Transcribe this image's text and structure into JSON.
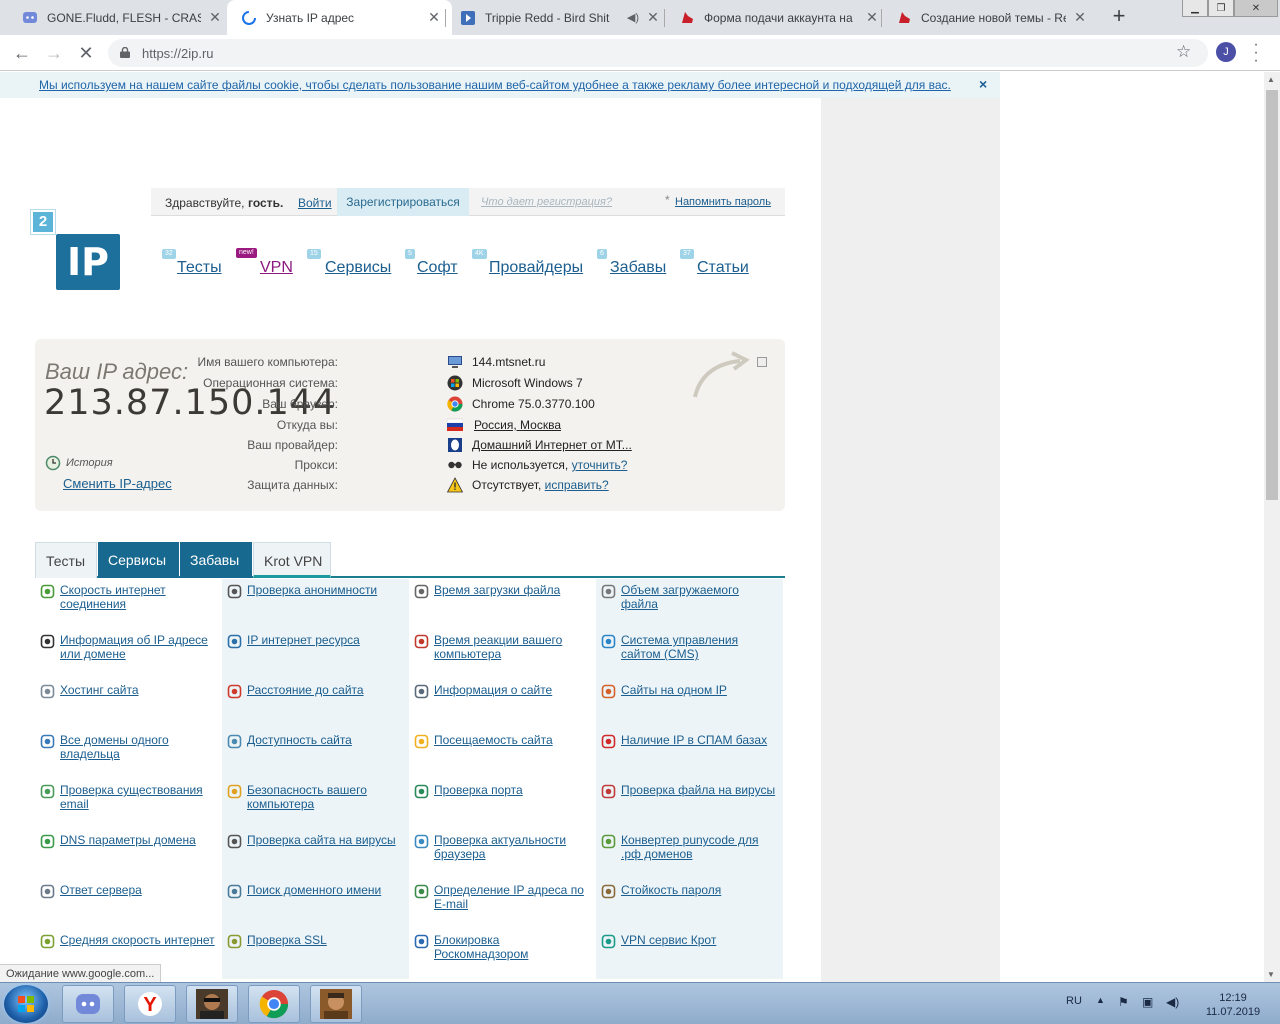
{
  "browser": {
    "tabs": [
      {
        "title": "GONE.Fludd, FLESH - CRASH",
        "icon": "discord-icon",
        "active": false
      },
      {
        "title": "Узнать IP адрес",
        "icon": "loading-spinner-icon",
        "active": true
      },
      {
        "title": "Trippie Redd - Bird Shit",
        "icon": "play-icon",
        "active": false
      },
      {
        "title": "Форма подачи аккаунта на",
        "icon": "red-shoe-icon",
        "active": false
      },
      {
        "title": "Создание новой темы - Rev",
        "icon": "red-shoe-icon",
        "active": false
      }
    ],
    "url": "https://2ip.ru",
    "avatar_letter": "J",
    "status_text": "Ожидание www.google.com..."
  },
  "cookie_notice": {
    "text": "Мы используем на нашем сайте файлы cookie, чтобы сделать пользование нашим веб-сайтом удобнее а также рекламу более интересной и подходящей для вас.",
    "close": "×"
  },
  "auth": {
    "greeting": "Здравствуйте,",
    "guest": "гость.",
    "login": "Войти",
    "register": "Зарегистрироваться",
    "why_register": "Что дает регистрация?",
    "asterisk": "*",
    "remind": "Напомнить пароль"
  },
  "logo": {
    "top": "2",
    "main": "IP"
  },
  "main_nav": [
    {
      "label": "Тесты",
      "badge": "32"
    },
    {
      "label": "VPN",
      "badge": "new!"
    },
    {
      "label": "Сервисы",
      "badge": "15"
    },
    {
      "label": "Софт",
      "badge": "5"
    },
    {
      "label": "Провайдеры",
      "badge": "4K"
    },
    {
      "label": "Забавы",
      "badge": "6"
    },
    {
      "label": "Статьи",
      "badge": "37"
    }
  ],
  "ip_panel": {
    "label": "Ваш IP адрес:",
    "ip": "213.87.150.144",
    "history": "История",
    "change_ip": "Сменить IP-адрес",
    "rows": [
      {
        "label": "Имя вашего компьютера:",
        "value": "144.mtsnet.ru",
        "link": "",
        "icon": "computer-icon"
      },
      {
        "label": "Операционная система:",
        "value": "Microsoft Windows 7",
        "link": "",
        "icon": "windows-icon"
      },
      {
        "label": "Ваш браузер:",
        "value": "Chrome 75.0.3770.100",
        "link": "",
        "icon": "chrome-icon"
      },
      {
        "label": "Откуда вы:",
        "value": "",
        "link": "Россия, Москва",
        "icon": "russia-flag-icon"
      },
      {
        "label": "Ваш провайдер:",
        "value": "",
        "link": "Домашний Интернет от МТ...",
        "icon": "provider-icon"
      },
      {
        "label": "Прокси:",
        "value": "Не используется,",
        "link": "уточнить?",
        "icon": "glasses-icon"
      },
      {
        "label": "Защита данных:",
        "value": "Отсутствует,",
        "link": "исправить?",
        "icon": "warning-icon"
      }
    ]
  },
  "section_tabs": [
    {
      "label": "Тесты",
      "style": "plain"
    },
    {
      "label": "Сервисы",
      "style": "dark"
    },
    {
      "label": "Забавы",
      "style": "dark"
    },
    {
      "label": "Krot VPN",
      "style": "krot"
    }
  ],
  "services": [
    {
      "text": "Скорость интернет соединения",
      "icon": "speed-arrow-icon",
      "color": "#4a9a3a"
    },
    {
      "text": "Проверка анонимности",
      "icon": "spy-icon",
      "color": "#555555"
    },
    {
      "text": "Время загрузки файла",
      "icon": "clock-icon",
      "color": "#666666"
    },
    {
      "text": "Объем загружаемого файла",
      "icon": "file-size-icon",
      "color": "#777777"
    },
    {
      "text": "Информация об IP адресе или домене",
      "icon": "ip-box-icon",
      "color": "#333333"
    },
    {
      "text": "IP интернет ресурса",
      "icon": "ip-circle-icon",
      "color": "#2a6fa8"
    },
    {
      "text": "Время реакции вашего компьютера",
      "icon": "refresh-icon",
      "color": "#c0392b"
    },
    {
      "text": "Система управления сайтом (CMS)",
      "icon": "cms-icon",
      "color": "#2a86c9"
    },
    {
      "text": "Хостинг сайта",
      "icon": "server-icon",
      "color": "#7a8a99"
    },
    {
      "text": "Расстояние до сайта",
      "icon": "map-pin-icon",
      "color": "#d03a2a"
    },
    {
      "text": "Информация о сайте",
      "icon": "document-icon",
      "color": "#5a6a7a"
    },
    {
      "text": "Сайты на одном IP",
      "icon": "network-icon",
      "color": "#d4612a"
    },
    {
      "text": "Все домены одного владельца",
      "icon": "globe-user-icon",
      "color": "#3a7ab8"
    },
    {
      "text": "Доступность сайта",
      "icon": "globe-check-icon",
      "color": "#4a8ab0"
    },
    {
      "text": "Посещаемость сайта",
      "icon": "star-icon",
      "color": "#f0b020"
    },
    {
      "text": "Наличие IP в СПАМ базах",
      "icon": "no-spam-icon",
      "color": "#d02a2a"
    },
    {
      "text": "Проверка существования email",
      "icon": "email-check-icon",
      "color": "#4a9a5a"
    },
    {
      "text": "Безопасность вашего компьютера",
      "icon": "lock-icon",
      "color": "#e0a020"
    },
    {
      "text": "Проверка порта",
      "icon": "globe-icon",
      "color": "#2a8a5a"
    },
    {
      "text": "Проверка файла на вирусы",
      "icon": "virus-file-icon",
      "color": "#c03a3a"
    },
    {
      "text": "DNS параметры домена",
      "icon": "dns-icon",
      "color": "#3a9a4a"
    },
    {
      "text": "Проверка сайта на вирусы",
      "icon": "virus-spy-icon",
      "color": "#555555"
    },
    {
      "text": "Проверка актуальности браузера",
      "icon": "browser-refresh-icon",
      "color": "#3a8ac0"
    },
    {
      "text": "Конвертер punycode для .рф доменов",
      "icon": "converter-icon",
      "color": "#5a9a3a"
    },
    {
      "text": "Ответ сервера",
      "icon": "server-response-icon",
      "color": "#6a7a8a"
    },
    {
      "text": "Поиск доменного имени",
      "icon": "domain-search-icon",
      "color": "#4a7a9a"
    },
    {
      "text": "Определение IP адреса по E-mail",
      "icon": "email-ip-icon",
      "color": "#3a8a4a"
    },
    {
      "text": "Стойкость пароля",
      "icon": "password-key-icon",
      "color": "#8a6a3a"
    },
    {
      "text": "Средняя скорость интернет",
      "icon": "speed-bars-icon",
      "color": "#7aa030"
    },
    {
      "text": "Проверка SSL",
      "icon": "ssl-icon",
      "color": "#8a9a30"
    },
    {
      "text": "Блокировка Роскомнадзором",
      "icon": "rkn-block-icon",
      "color": "#2a6ab0"
    },
    {
      "text": "VPN сервис Крот",
      "icon": "krot-vpn-icon",
      "color": "#1b9a8a"
    }
  ],
  "taskbar": {
    "apps": [
      "discord-app-icon",
      "yandex-browser-icon",
      "game-character-icon",
      "chrome-app-icon",
      "game-character-2-icon"
    ],
    "lang": "RU",
    "time": "12:19",
    "date": "11.07.2019"
  },
  "colors": {
    "accent": "#1d6f9c",
    "link": "#1b5e8f",
    "tab_dark": "#17698f",
    "panel_bg": "#f4f2ee"
  }
}
